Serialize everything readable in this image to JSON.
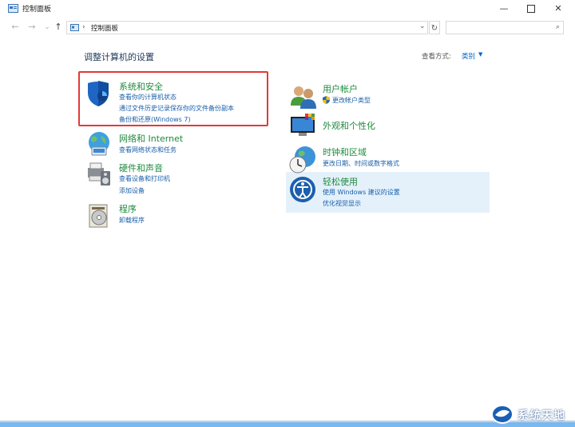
{
  "window": {
    "title": "控制面板",
    "controls": {
      "minimize": "—",
      "close": "✕"
    }
  },
  "nav": {
    "back": "←",
    "forward": "→",
    "recent": "⌄",
    "up": "↑",
    "address_separator": "›",
    "address_text": "控制面板",
    "dropdown": "⌄",
    "refresh": "↻",
    "search_placeholder": "",
    "search_icon": "⌕"
  },
  "content": {
    "heading": "调整计算机的设置",
    "view_by_label": "查看方式:",
    "view_by_value": "类别",
    "view_by_arrow": "▼"
  },
  "categories_left": [
    {
      "title": "系统和安全",
      "icon": "shield-icon",
      "links": [
        "查看你的计算机状态",
        "通过文件历史记录保存你的文件备份副本",
        "备份和还原(Windows 7)"
      ]
    },
    {
      "title": "网络和 Internet",
      "icon": "network-globe-icon",
      "links": [
        "查看网络状态和任务"
      ]
    },
    {
      "title": "硬件和声音",
      "icon": "printer-speaker-icon",
      "links": [
        "查看设备和打印机",
        "添加设备"
      ]
    },
    {
      "title": "程序",
      "icon": "program-disc-icon",
      "links": [
        "卸载程序"
      ]
    }
  ],
  "categories_right": [
    {
      "title": "用户帐户",
      "icon": "users-icon",
      "links": [
        "更改帐户类型"
      ]
    },
    {
      "title": "外观和个性化",
      "icon": "monitor-palette-icon",
      "links": []
    },
    {
      "title": "时钟和区域",
      "icon": "clock-globe-icon",
      "links": [
        "更改日期、时间或数字格式"
      ]
    },
    {
      "title": "轻松使用",
      "icon": "accessibility-icon",
      "links": [
        "使用 Windows 建议的设置",
        "优化视觉显示"
      ]
    }
  ],
  "watermark": {
    "text": "系统天地",
    "icon": "watermark-logo-icon"
  },
  "colors": {
    "category_title": "#1e8a3c",
    "link": "#1a5ea8",
    "heading": "#1e395b",
    "highlight_border": "#e23a3a",
    "selected_bg": "#e4f1fb"
  }
}
